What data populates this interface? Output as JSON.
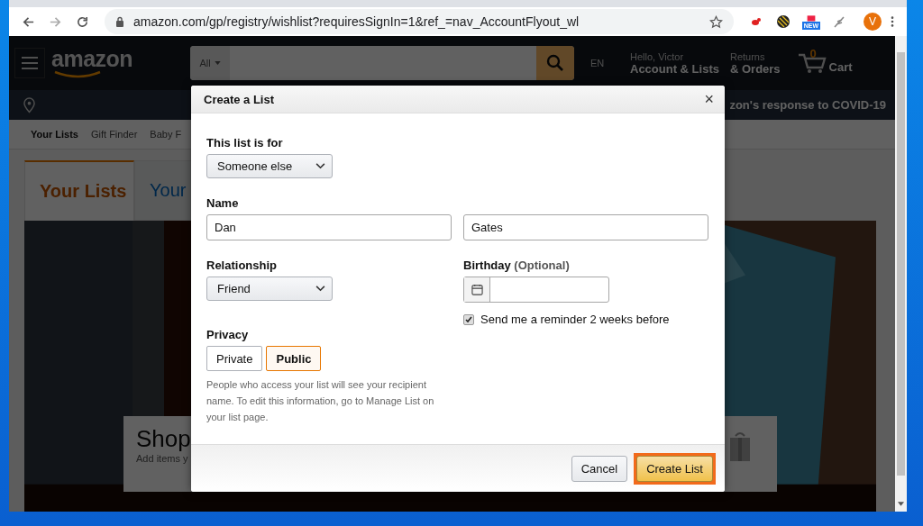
{
  "browser": {
    "url": "amazon.com/gp/registry/wishlist?requiresSignIn=1&ref_=nav_AccountFlyout_wl",
    "new_badge": "NEW",
    "profile_initial": "V"
  },
  "header": {
    "logo": "amazon",
    "search_category": "All",
    "language": "EN",
    "greeting": "Hello, Victor",
    "account": "Account & Lists",
    "returns": "Returns",
    "orders": "& Orders",
    "cart_count": "0",
    "cart": "Cart",
    "banner": "zon's response to COVID-19"
  },
  "subnav": [
    {
      "label": "Your Lists",
      "selected": true
    },
    {
      "label": "Gift Finder",
      "selected": false
    },
    {
      "label": "Baby F",
      "selected": false
    }
  ],
  "page_tabs": [
    {
      "label": "Your Lists",
      "selected": true
    },
    {
      "label": "Your",
      "selected": false
    }
  ],
  "promo": {
    "title": "Shop",
    "text": "Add items y"
  },
  "dialog": {
    "title": "Create a List",
    "close": "×",
    "list_for": {
      "label": "This list is for",
      "value": "Someone else"
    },
    "name": {
      "label": "Name",
      "first": "Dan",
      "last": "Gates"
    },
    "relationship": {
      "label": "Relationship",
      "value": "Friend"
    },
    "birthday": {
      "label": "Birthday",
      "optional": "(Optional)"
    },
    "reminder": {
      "label": "Send me a reminder 2 weeks before",
      "checked": true
    },
    "privacy": {
      "label": "Privacy",
      "note": "People who access your list will see your recipient name. To edit this information, go to Manage List on your list page.",
      "options": [
        {
          "label": "Private",
          "selected": false
        },
        {
          "label": "Public",
          "selected": true
        }
      ]
    },
    "buttons": [
      {
        "label": "Cancel",
        "kind": "secondary",
        "highlighted": false
      },
      {
        "label": "Create List",
        "kind": "primary",
        "highlighted": true
      }
    ]
  }
}
